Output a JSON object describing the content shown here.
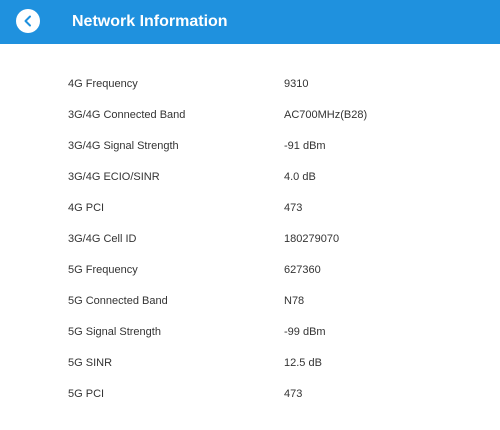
{
  "header": {
    "title": "Network Information",
    "back_icon": "chevron-left-icon",
    "background_color": "#1f91de"
  },
  "rows": [
    {
      "label": "4G Frequency",
      "value": "9310"
    },
    {
      "label": "3G/4G Connected Band",
      "value": "AC700MHz(B28)"
    },
    {
      "label": "3G/4G Signal Strength",
      "value": "-91 dBm"
    },
    {
      "label": "3G/4G ECIO/SINR",
      "value": "4.0 dB"
    },
    {
      "label": "4G PCI",
      "value": "473"
    },
    {
      "label": "3G/4G Cell ID",
      "value": "180279070"
    },
    {
      "label": "5G Frequency",
      "value": "627360"
    },
    {
      "label": "5G Connected Band",
      "value": "N78"
    },
    {
      "label": "5G Signal Strength",
      "value": "-99 dBm"
    },
    {
      "label": "5G SINR",
      "value": "12.5 dB"
    },
    {
      "label": "5G PCI",
      "value": "473"
    }
  ]
}
